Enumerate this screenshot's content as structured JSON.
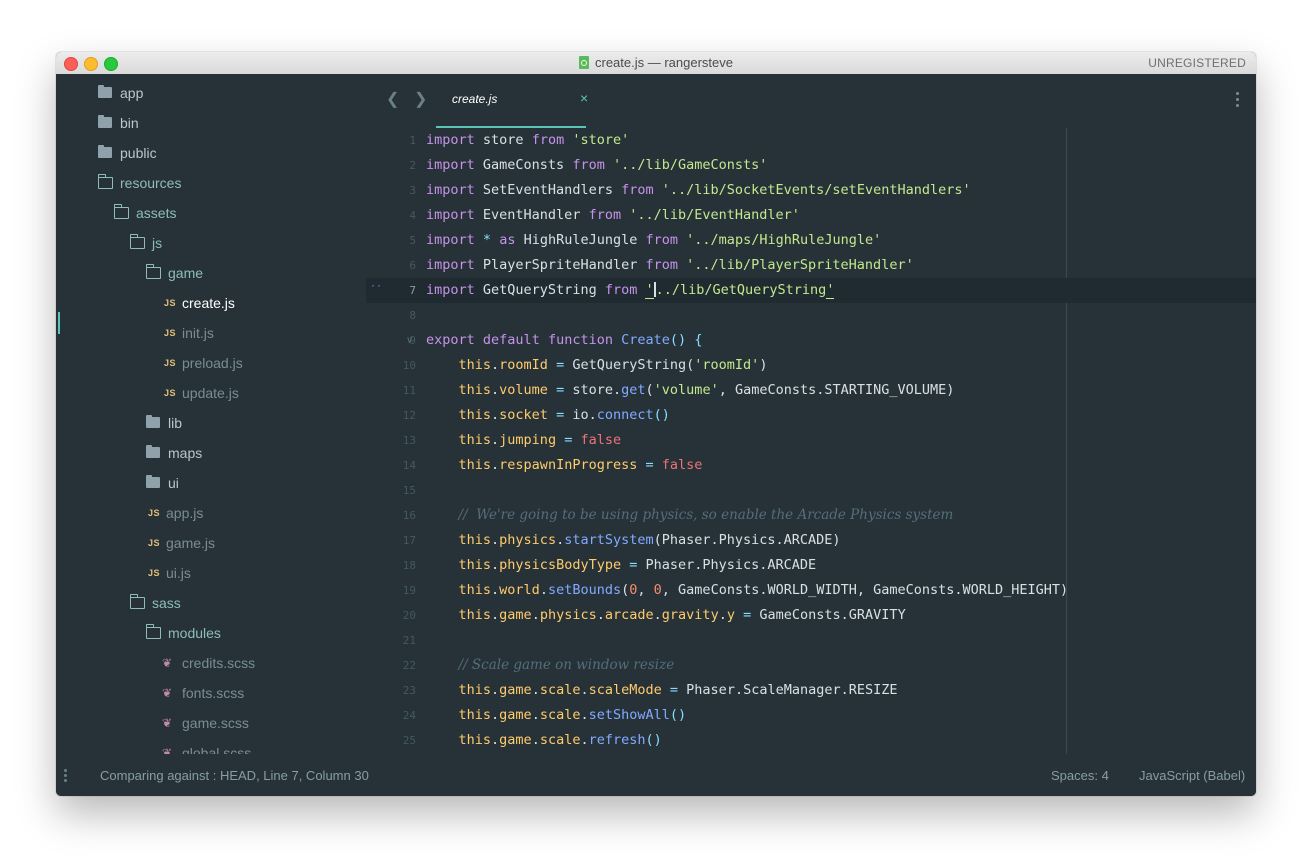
{
  "window": {
    "title": "create.js — rangersteve",
    "registration": "UNREGISTERED"
  },
  "sidebar": {
    "items": [
      {
        "label": "app",
        "type": "folder-closed"
      },
      {
        "label": "bin",
        "type": "folder-closed"
      },
      {
        "label": "public",
        "type": "folder-closed"
      },
      {
        "label": "resources",
        "type": "folder-open"
      },
      {
        "label": "assets",
        "type": "folder-open"
      },
      {
        "label": "js",
        "type": "folder-open"
      },
      {
        "label": "game",
        "type": "folder-open"
      },
      {
        "label": "create.js",
        "type": "js",
        "icon_text": "JS",
        "active": true
      },
      {
        "label": "init.js",
        "type": "js",
        "icon_text": "JS"
      },
      {
        "label": "preload.js",
        "type": "js",
        "icon_text": "JS"
      },
      {
        "label": "update.js",
        "type": "js",
        "icon_text": "JS"
      },
      {
        "label": "lib",
        "type": "folder-closed"
      },
      {
        "label": "maps",
        "type": "folder-closed"
      },
      {
        "label": "ui",
        "type": "folder-closed"
      },
      {
        "label": "app.js",
        "type": "js",
        "icon_text": "JS"
      },
      {
        "label": "game.js",
        "type": "js",
        "icon_text": "JS"
      },
      {
        "label": "ui.js",
        "type": "js",
        "icon_text": "JS"
      },
      {
        "label": "sass",
        "type": "folder-open"
      },
      {
        "label": "modules",
        "type": "folder-open"
      },
      {
        "label": "credits.scss",
        "type": "scss"
      },
      {
        "label": "fonts.scss",
        "type": "scss"
      },
      {
        "label": "game.scss",
        "type": "scss"
      },
      {
        "label": "global.scss",
        "type": "scss"
      }
    ]
  },
  "tabs": {
    "back_icon": "chevron-left-icon",
    "forward_icon": "chevron-right-icon",
    "items": [
      {
        "label": "create.js",
        "close": "×"
      }
    ]
  },
  "editor": {
    "line_numbers": [
      "1",
      "2",
      "3",
      "4",
      "5",
      "6",
      "7",
      "8",
      "9",
      "10",
      "11",
      "12",
      "13",
      "14",
      "15",
      "16",
      "17",
      "18",
      "19",
      "20",
      "21",
      "22",
      "23",
      "24",
      "25"
    ],
    "current_line": 7
  },
  "status": {
    "left": "Comparing against : HEAD, Line 7, Column 30",
    "spaces": "Spaces: 4",
    "syntax": "JavaScript (Babel)"
  },
  "colors": {
    "background": "#263238",
    "accent": "#5dc2b8",
    "keyword": "#c792ea",
    "string": "#c3e88d",
    "this": "#ffcb6b",
    "function": "#82aaff",
    "boolean": "#f07178",
    "number": "#f78c6c"
  }
}
